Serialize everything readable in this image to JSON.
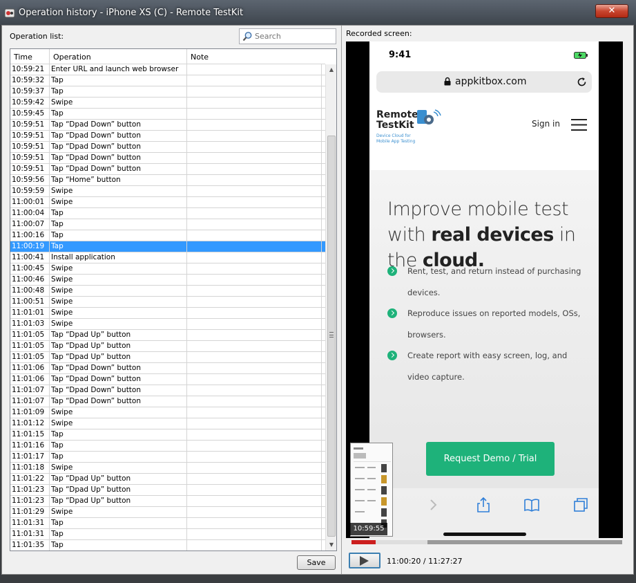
{
  "window": {
    "title": "Operation history - iPhone XS (C) - Remote TestKit",
    "close_label": "✕"
  },
  "left": {
    "operation_list_label": "Operation list:",
    "search_placeholder": "Search",
    "columns": [
      "Time",
      "Operation",
      "Note"
    ],
    "rows": [
      {
        "time": "10:59:21",
        "op": "Enter URL and launch web browser",
        "note": ""
      },
      {
        "time": "10:59:32",
        "op": "Tap",
        "note": ""
      },
      {
        "time": "10:59:37",
        "op": "Tap",
        "note": ""
      },
      {
        "time": "10:59:42",
        "op": "Swipe",
        "note": ""
      },
      {
        "time": "10:59:45",
        "op": "Tap",
        "note": ""
      },
      {
        "time": "10:59:51",
        "op": "Tap “Dpad Down” button",
        "note": ""
      },
      {
        "time": "10:59:51",
        "op": "Tap “Dpad Down” button",
        "note": ""
      },
      {
        "time": "10:59:51",
        "op": "Tap “Dpad Down” button",
        "note": ""
      },
      {
        "time": "10:59:51",
        "op": "Tap “Dpad Down” button",
        "note": ""
      },
      {
        "time": "10:59:51",
        "op": "Tap “Dpad Down” button",
        "note": ""
      },
      {
        "time": "10:59:56",
        "op": "Tap “Home” button",
        "note": ""
      },
      {
        "time": "10:59:59",
        "op": "Swipe",
        "note": ""
      },
      {
        "time": "11:00:01",
        "op": "Swipe",
        "note": ""
      },
      {
        "time": "11:00:04",
        "op": "Tap",
        "note": ""
      },
      {
        "time": "11:00:07",
        "op": "Tap",
        "note": ""
      },
      {
        "time": "11:00:16",
        "op": "Tap",
        "note": ""
      },
      {
        "time": "11:00:19",
        "op": "Tap",
        "note": "",
        "selected": true
      },
      {
        "time": "11:00:41",
        "op": "Install application",
        "note": ""
      },
      {
        "time": "11:00:45",
        "op": "Swipe",
        "note": ""
      },
      {
        "time": "11:00:46",
        "op": "Swipe",
        "note": ""
      },
      {
        "time": "11:00:48",
        "op": "Swipe",
        "note": ""
      },
      {
        "time": "11:00:51",
        "op": "Swipe",
        "note": ""
      },
      {
        "time": "11:01:01",
        "op": "Swipe",
        "note": ""
      },
      {
        "time": "11:01:03",
        "op": "Swipe",
        "note": ""
      },
      {
        "time": "11:01:05",
        "op": "Tap “Dpad Up” button",
        "note": ""
      },
      {
        "time": "11:01:05",
        "op": "Tap “Dpad Up” button",
        "note": ""
      },
      {
        "time": "11:01:05",
        "op": "Tap “Dpad Up” button",
        "note": ""
      },
      {
        "time": "11:01:06",
        "op": "Tap “Dpad Down” button",
        "note": ""
      },
      {
        "time": "11:01:06",
        "op": "Tap “Dpad Down” button",
        "note": ""
      },
      {
        "time": "11:01:07",
        "op": "Tap “Dpad Down” button",
        "note": ""
      },
      {
        "time": "11:01:07",
        "op": "Tap “Dpad Down” button",
        "note": ""
      },
      {
        "time": "11:01:09",
        "op": "Swipe",
        "note": ""
      },
      {
        "time": "11:01:12",
        "op": "Swipe",
        "note": ""
      },
      {
        "time": "11:01:15",
        "op": "Tap",
        "note": ""
      },
      {
        "time": "11:01:16",
        "op": "Tap",
        "note": ""
      },
      {
        "time": "11:01:17",
        "op": "Tap",
        "note": ""
      },
      {
        "time": "11:01:18",
        "op": "Swipe",
        "note": ""
      },
      {
        "time": "11:01:22",
        "op": "Tap “Dpad Up” button",
        "note": ""
      },
      {
        "time": "11:01:23",
        "op": "Tap “Dpad Up” button",
        "note": ""
      },
      {
        "time": "11:01:23",
        "op": "Tap “Dpad Up” button",
        "note": ""
      },
      {
        "time": "11:01:29",
        "op": "Swipe",
        "note": ""
      },
      {
        "time": "11:01:31",
        "op": "Tap",
        "note": ""
      },
      {
        "time": "11:01:31",
        "op": "Tap",
        "note": ""
      },
      {
        "time": "11:01:35",
        "op": "Tap",
        "note": ""
      }
    ],
    "save_label": "Save",
    "selection_color": "#3399ff"
  },
  "right": {
    "recorded_label": "Recorded screen:",
    "phone": {
      "status_time": "9:41",
      "url": "appkitbox.com",
      "logo_line1": "Remote",
      "logo_line2": "TestKit",
      "logo_sub": "Device Cloud for Mobile App Testing",
      "sign_in": "Sign in",
      "hero_1": "Improve mobile test",
      "hero_2a": "with ",
      "hero_2b": "real devices",
      "hero_2c": " in",
      "hero_3a": "the ",
      "hero_3b": "cloud.",
      "bullets": [
        "Rent, test, and return instead of purchasing devices.",
        "Reproduce issues on reported models, OSs, browsers.",
        "Create report with easy screen, log, and video capture."
      ],
      "cta": "Request Demo / Trial",
      "accent": "#1eb27a"
    },
    "thumbnail_time": "10:59:55",
    "playback": {
      "current": "11:00:20",
      "total": "11:27:27",
      "separator": " / ",
      "progress": 0.09,
      "buffered": 0.28
    }
  }
}
